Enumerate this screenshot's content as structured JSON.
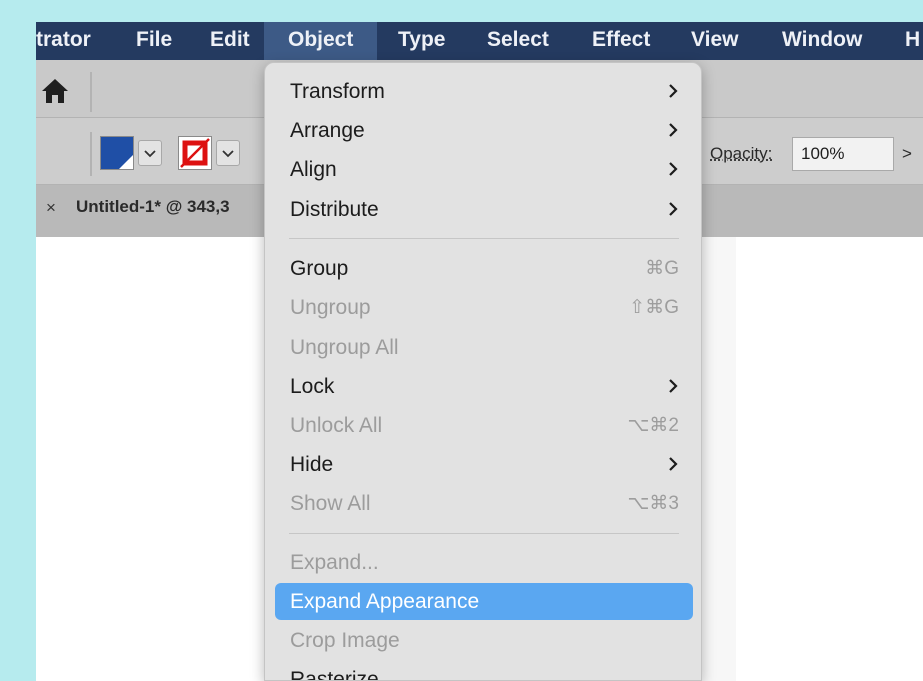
{
  "menubar": {
    "items": [
      {
        "label": "trator"
      },
      {
        "label": "File"
      },
      {
        "label": "Edit"
      },
      {
        "label": "Object"
      },
      {
        "label": "Type"
      },
      {
        "label": "Select"
      },
      {
        "label": "Effect"
      },
      {
        "label": "View"
      },
      {
        "label": "Window"
      },
      {
        "label": "H"
      }
    ],
    "active_item": "Object"
  },
  "controlbar": {
    "fill_color": "#1f4fa6",
    "stroke_state": "none",
    "opacity_label": "Opacity:",
    "opacity_value": "100%",
    "more_glyph": ">"
  },
  "document_tab": {
    "close_glyph": "×",
    "title": "Untitled-1* @ 343,3"
  },
  "object_menu": {
    "items": [
      {
        "label": "Transform",
        "submenu": true
      },
      {
        "label": "Arrange",
        "submenu": true
      },
      {
        "label": "Align",
        "submenu": true
      },
      {
        "label": "Distribute",
        "submenu": true
      },
      {
        "label": "Group",
        "shortcut": "⌘G"
      },
      {
        "label": "Ungroup",
        "shortcut": "⇧⌘G",
        "disabled": true
      },
      {
        "label": "Ungroup All",
        "disabled": true
      },
      {
        "label": "Lock",
        "submenu": true
      },
      {
        "label": "Unlock All",
        "shortcut": "⌥⌘2",
        "disabled": true
      },
      {
        "label": "Hide",
        "submenu": true
      },
      {
        "label": "Show All",
        "shortcut": "⌥⌘3",
        "disabled": true
      },
      {
        "label": "Expand...",
        "disabled": true
      },
      {
        "label": "Expand Appearance",
        "highlighted": true
      },
      {
        "label": "Crop Image",
        "disabled": true
      },
      {
        "label": "Rasterize..."
      }
    ]
  },
  "colors": {
    "background": "#b6ebee",
    "menubar": "#243a60",
    "menubar_active": "#3d5a86",
    "highlight": "#5aa7f1"
  }
}
